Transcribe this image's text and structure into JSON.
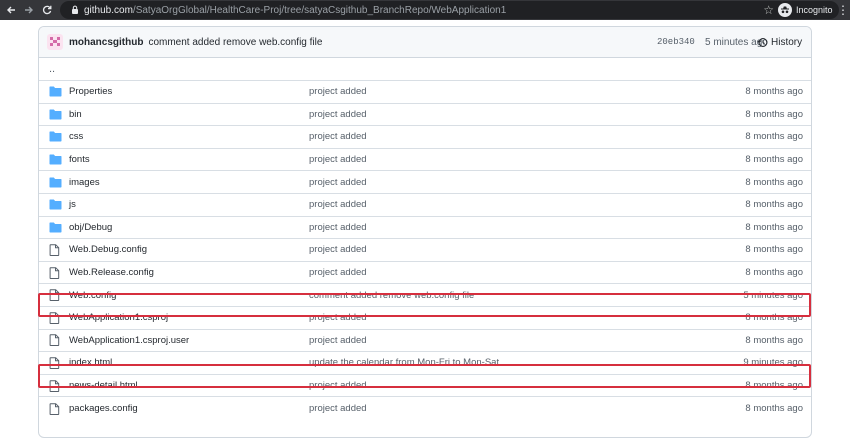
{
  "browser": {
    "url_host": "github.com",
    "url_path": "/SatyaOrgGlobal/HealthCare-Proj/tree/satyaCsgithub_BranchRepo/WebApplication1",
    "profile_label": "Incognito"
  },
  "commit": {
    "author": "mohancsgithub",
    "message": "comment added remove web.config file",
    "sha": "20eb340",
    "time": "5 minutes ago",
    "history_label": "History"
  },
  "parent_dir": "..",
  "files": [
    {
      "name": "Properties",
      "type": "folder",
      "message": "project added",
      "age": "8 months ago"
    },
    {
      "name": "bin",
      "type": "folder",
      "message": "project added",
      "age": "8 months ago"
    },
    {
      "name": "css",
      "type": "folder",
      "message": "project added",
      "age": "8 months ago"
    },
    {
      "name": "fonts",
      "type": "folder",
      "message": "project added",
      "age": "8 months ago"
    },
    {
      "name": "images",
      "type": "folder",
      "message": "project added",
      "age": "8 months ago"
    },
    {
      "name": "js",
      "type": "folder",
      "message": "project added",
      "age": "8 months ago"
    },
    {
      "name": "obj/Debug",
      "type": "folder",
      "message": "project added",
      "age": "8 months ago"
    },
    {
      "name": "Web.Debug.config",
      "type": "file",
      "message": "project added",
      "age": "8 months ago"
    },
    {
      "name": "Web.Release.config",
      "type": "file",
      "message": "project added",
      "age": "8 months ago"
    },
    {
      "name": "Web.config",
      "type": "file",
      "message": "comment added remove web.config file",
      "age": "5 minutes ago",
      "highlighted": true
    },
    {
      "name": "WebApplication1.csproj",
      "type": "file",
      "message": "project added",
      "age": "8 months ago"
    },
    {
      "name": "WebApplication1.csproj.user",
      "type": "file",
      "message": "project added",
      "age": "8 months ago"
    },
    {
      "name": "index.html",
      "type": "file",
      "message": "update the calendar from Mon-Fri to Mon-Sat",
      "age": "9 minutes ago",
      "highlighted": true
    },
    {
      "name": "news-detail.html",
      "type": "file",
      "message": "project added",
      "age": "8 months ago"
    },
    {
      "name": "packages.config",
      "type": "file",
      "message": "project added",
      "age": "8 months ago"
    }
  ],
  "colors": {
    "folder_icon": "#54aeff",
    "file_icon": "#57606a",
    "highlight_border": "#d62f3e"
  }
}
